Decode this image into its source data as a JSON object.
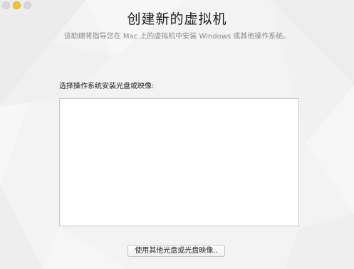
{
  "window": {
    "traffic_lights": {
      "close_color": "#d8d8d8",
      "minimize_color": "#f2c230",
      "zoom_color": "#d8d8d8"
    }
  },
  "header": {
    "title": "创建新的虚拟机",
    "subtitle": "该助理将指导您在 Mac 上的虚拟机中安装 Windows 或其他操作系统。"
  },
  "installer": {
    "list_label": "选择操作系统安装光盘或映像:",
    "items": []
  },
  "footer": {
    "other_button_label": "使用其他光盘或光盘映像.."
  }
}
